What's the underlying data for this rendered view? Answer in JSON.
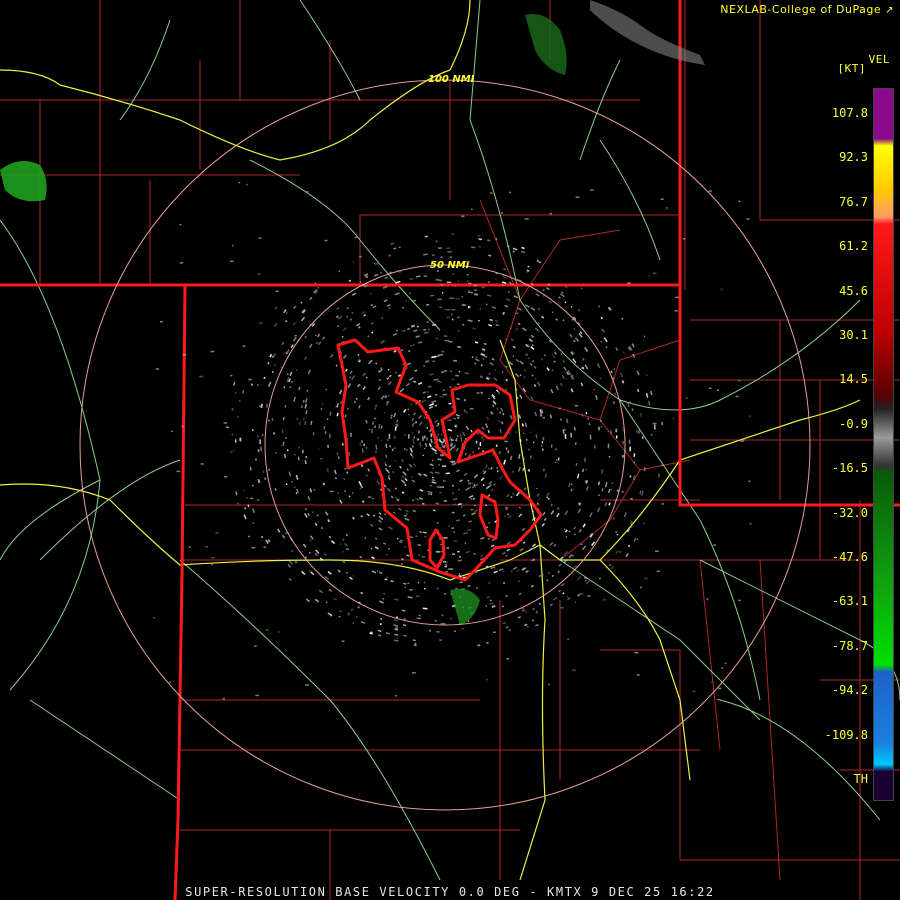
{
  "header": {
    "credit": "NEXLAB-College of DuPage",
    "credit_icon": "external-link-icon"
  },
  "legend": {
    "units_name": "VEL",
    "units_unit": "[KT]",
    "ticks": [
      "107.8",
      "92.3",
      "76.7",
      "61.2",
      "45.6",
      "30.1",
      "14.5",
      "-0.9",
      "-16.5",
      "-32.0",
      "-47.6",
      "-63.1",
      "-78.7",
      "-94.2",
      "-109.8",
      "TH"
    ],
    "colors": {
      "purple": "#8b0a8b",
      "yellow": "#ffff00",
      "orange": "#ff9966",
      "red": "#ff1a1a",
      "darkred": "#5a0000",
      "gray": "#9a9a9a",
      "darkgreen": "#0a5a0a",
      "green": "#00e000",
      "blue": "#1e60c8",
      "cyan": "#00c8ff",
      "th": "#1a0033"
    }
  },
  "range_rings": {
    "inner_label": "50 NMI",
    "outer_label": "100 NMI"
  },
  "colors": {
    "state_border": "#ff1a1a",
    "county_line": "#b0282a",
    "highway": "#f0f040",
    "road": "#9be49b",
    "ring": "#ffb0a0"
  },
  "footer": {
    "product": "SUPER-RESOLUTION BASE VELOCITY 0.0 DEG - KMTX 9 DEC 25 16:22"
  }
}
